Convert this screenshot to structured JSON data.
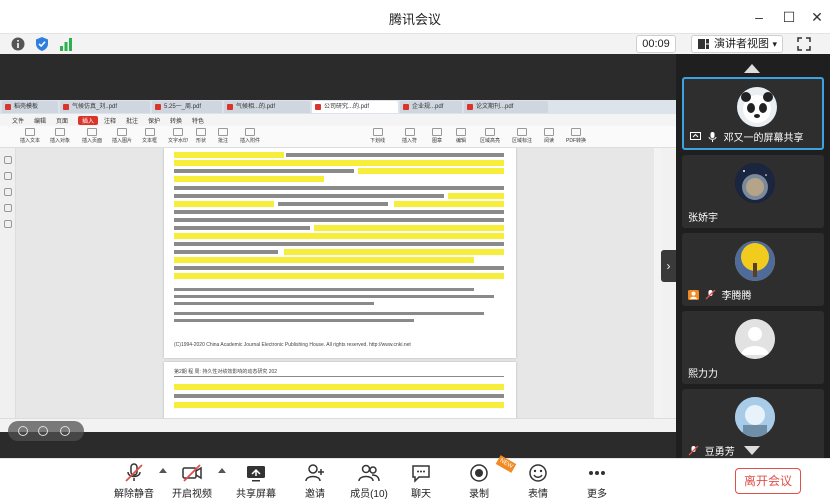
{
  "window": {
    "title": "腾讯会议"
  },
  "status": {
    "timer": "00:09",
    "view_mode": "演讲者视图"
  },
  "shared_doc": {
    "tabs": [
      "稻壳模板",
      "气候仿真_刘..pdf",
      "5.25一_周.pdf",
      "气候相...的.pdf",
      "公司研究...的.pdf",
      "企业规...pdf",
      "论文期刊...pdf"
    ],
    "menu": [
      "文件",
      "编辑",
      "页面",
      "插入",
      "注释",
      "批注",
      "保护",
      "转换",
      "特色"
    ],
    "ribbon": [
      "插入文本",
      "插入对象",
      "插入页面",
      "插入图片",
      "文本框",
      "文字水印",
      "形状",
      "批注",
      "插入附件",
      "下划线",
      "插入符",
      "图章",
      "编辑",
      "区域高亮",
      "区域标注",
      "阅读",
      "PDF转换"
    ],
    "footer_text": "(C)1994-2020 China Academic Journal Electronic Publishing House. All rights reserved.    http://www.cnki.net",
    "page2_header": "第2期          程 周: 持久性对绩效影响的动态研究          202"
  },
  "participants": [
    {
      "name": "邓又一的屏幕共享",
      "active": true
    },
    {
      "name": "张娇宇",
      "active": false
    },
    {
      "name": "李腾腾",
      "active": false
    },
    {
      "name": "熙力力",
      "active": false
    },
    {
      "name": "豆勇芳",
      "active": false
    }
  ],
  "toolbar": {
    "mute": "解除静音",
    "video": "开启视频",
    "share": "共享屏幕",
    "invite": "邀请",
    "members": "成员(10)",
    "chat": "聊天",
    "record": "录制",
    "emoji": "表情",
    "more": "更多",
    "leave": "离开会议"
  },
  "colors": {
    "accent": "#3aa3e0",
    "leave": "#e0504a",
    "highlight": "#f7ee3c"
  }
}
